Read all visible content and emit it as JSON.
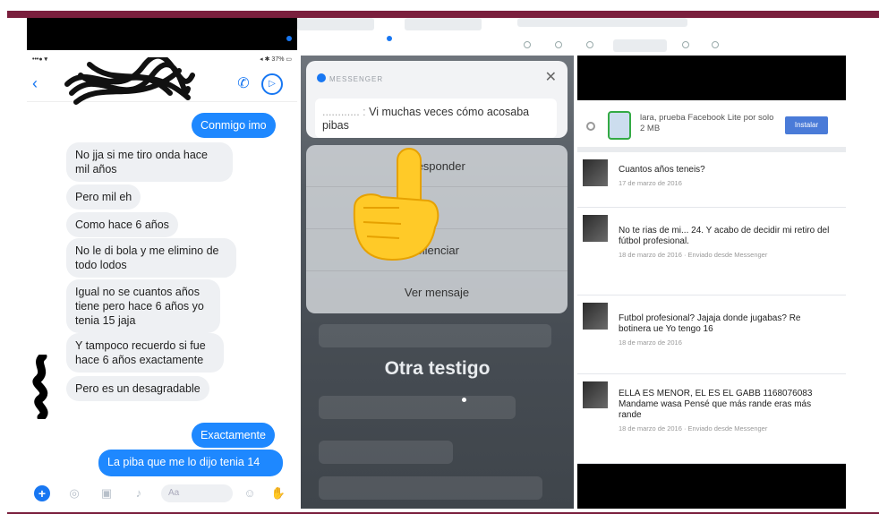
{
  "panel1": {
    "messages": [
      {
        "text": "Conmigo imo",
        "dir": "out"
      },
      {
        "text": "No jja si me tiro onda hace mil años",
        "dir": "in"
      },
      {
        "text": "Pero mil eh",
        "dir": "in"
      },
      {
        "text": "Como  hace 6 años",
        "dir": "in"
      },
      {
        "text": "No le di bola y me elimino de todo lodos",
        "dir": "in"
      },
      {
        "text": "Igual no se cuantos años tiene pero hace 6 años yo tenia 15 jaja",
        "dir": "in"
      },
      {
        "text": "Y tampoco recuerdo si fue hace 6 años exactamente",
        "dir": "in"
      },
      {
        "text": "Pero es un desagradable",
        "dir": "in"
      },
      {
        "text": "Exactamente",
        "dir": "out"
      },
      {
        "text": "La piba que me lo dijo tenia 14",
        "dir": "out"
      }
    ],
    "composer_placeholder": "Aa"
  },
  "panel2": {
    "app_name": "MESSENGER",
    "preview": "Vi muchas veces cómo acosaba pibas",
    "actions": [
      "Responder",
      "Silenciar",
      "Ver mensaje"
    ],
    "caption": "Otra testigo"
  },
  "panel3": {
    "ad": {
      "text": "lara, prueba Facebook Lite por solo 2 MB",
      "button": "Instalar"
    },
    "messages": [
      {
        "text": "Cuantos años teneis?",
        "time": "17 de marzo de 2016"
      },
      {
        "text": "No te rias de mi... 24. Y acabo de decidir mi retiro del fútbol profesional.",
        "time": "18 de marzo de 2016 · Enviado desde Messenger"
      },
      {
        "text": "Futbol profesional? Jajaja donde jugabas? Re botinera ue Yo tengo 16",
        "time": "18 de marzo de 2016"
      },
      {
        "text": "ELLA ES MENOR, EL ES EL GABB 1168076083 Mandame wasa Pensé que más rande eras más rande",
        "time": "18 de marzo de 2016 · Enviado desde Messenger"
      }
    ]
  },
  "colors": {
    "accent": "#7a1f3d",
    "messenger_blue": "#1e88ff",
    "fb_button": "#4a7bd8"
  }
}
